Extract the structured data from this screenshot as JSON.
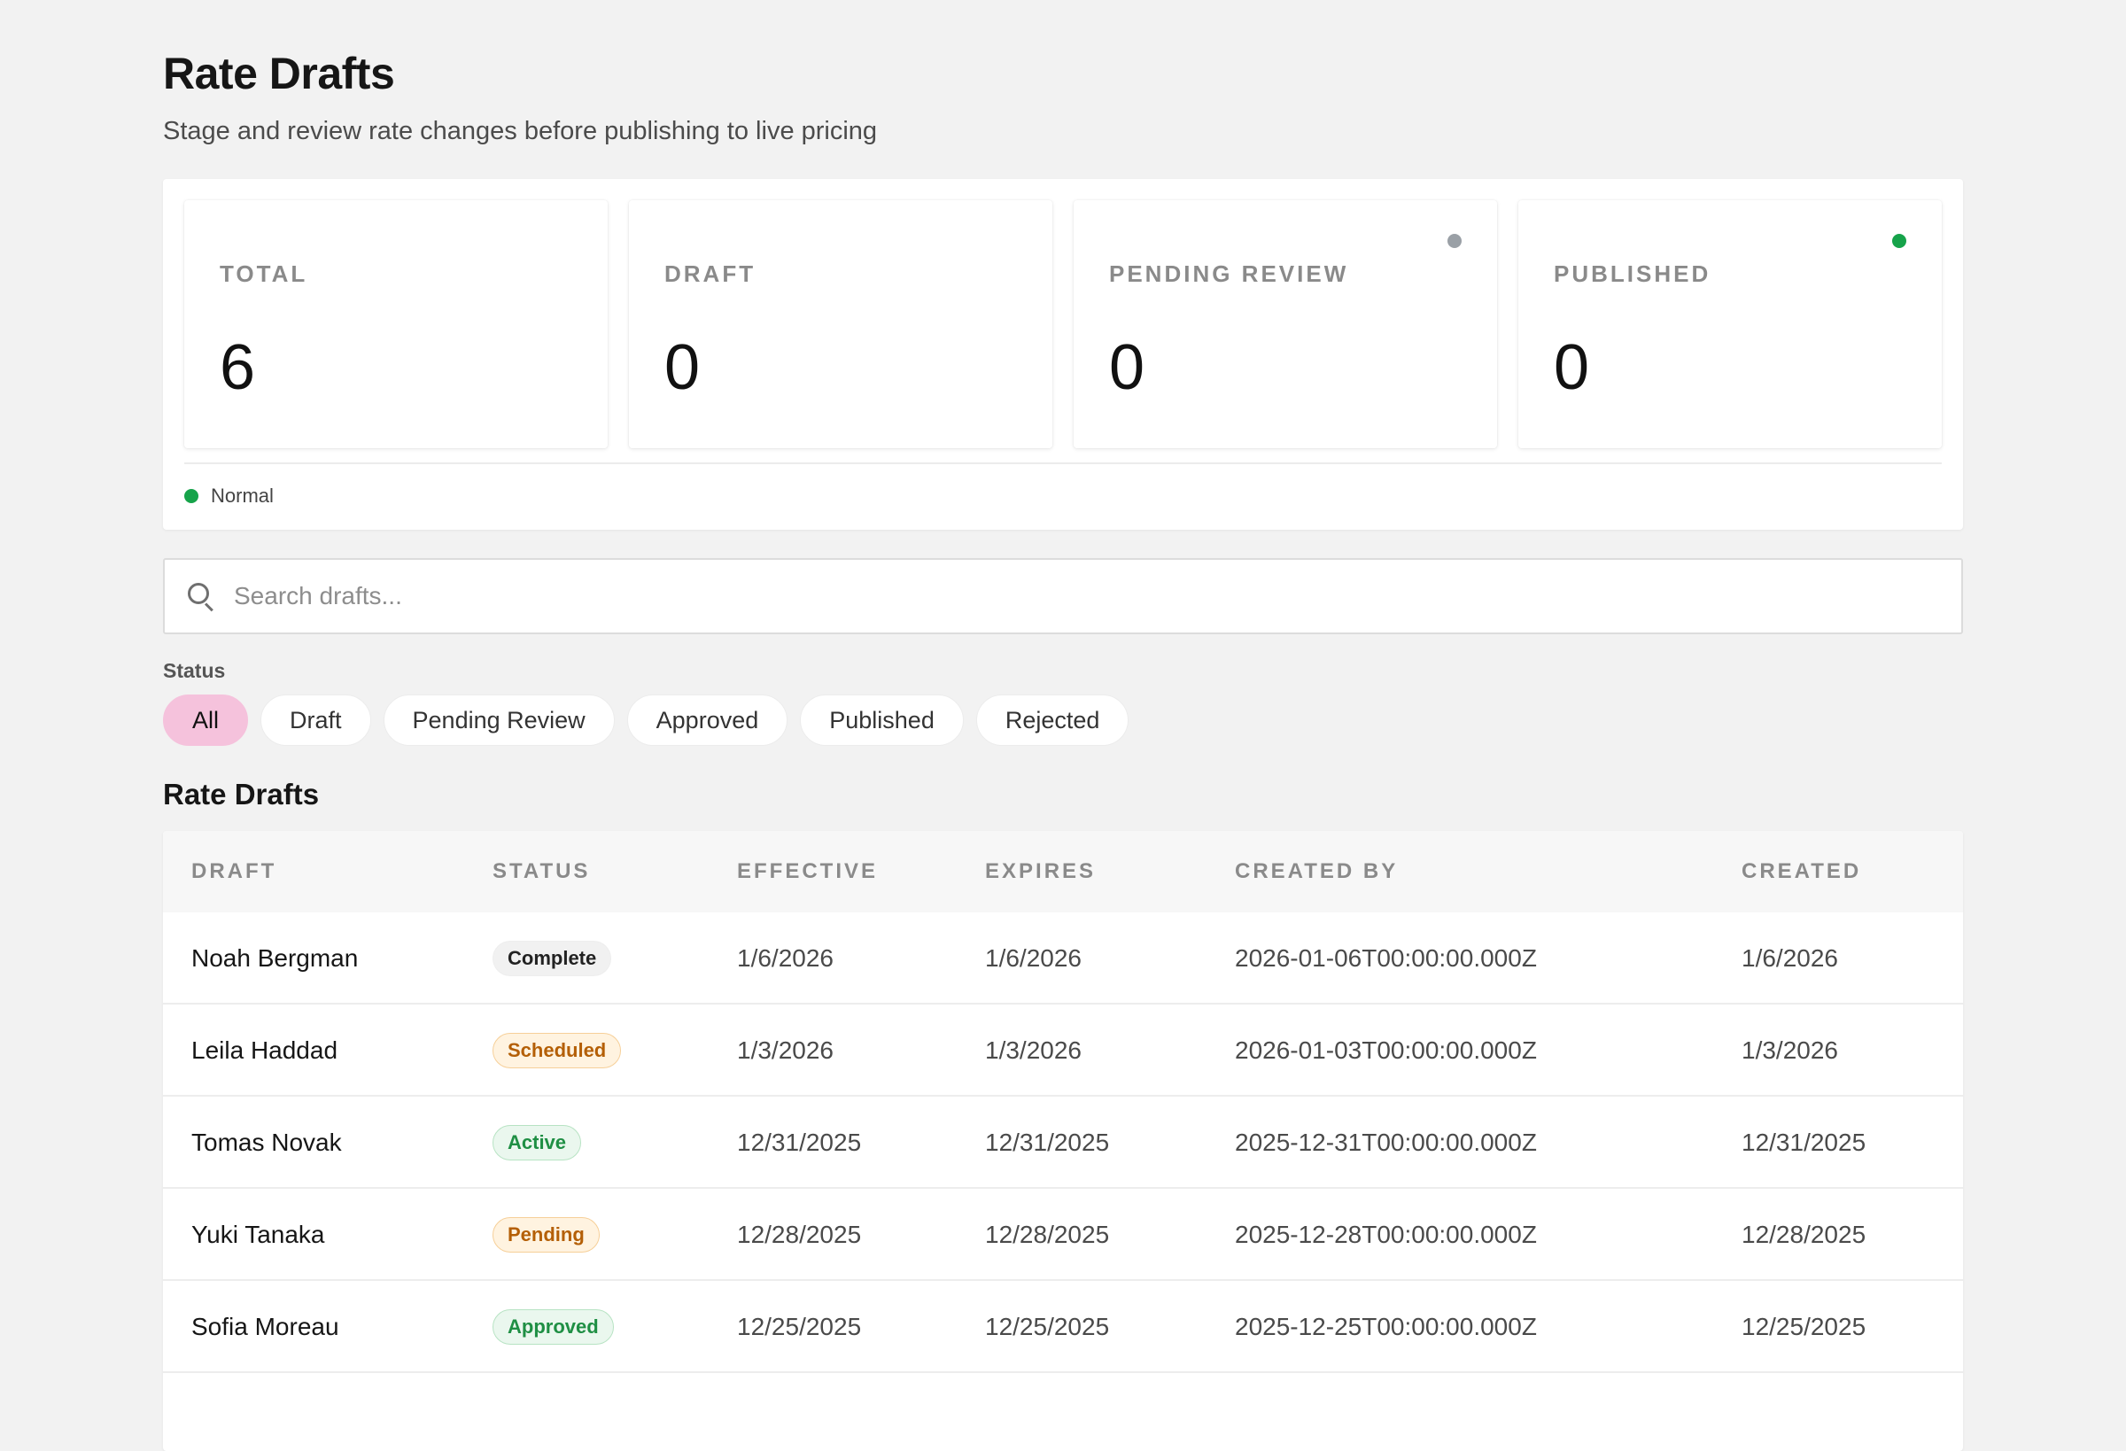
{
  "header": {
    "title": "Rate Drafts",
    "subtitle": "Stage and review rate changes before publishing to live pricing"
  },
  "stats": [
    {
      "label": "TOTAL",
      "value": "6",
      "dot": null
    },
    {
      "label": "DRAFT",
      "value": "0",
      "dot": null
    },
    {
      "label": "PENDING REVIEW",
      "value": "0",
      "dot": "#9aa0a6"
    },
    {
      "label": "PUBLISHED",
      "value": "0",
      "dot": "#16a34a"
    }
  ],
  "legend": {
    "label": "Normal",
    "color": "#16a34a"
  },
  "search": {
    "placeholder": "Search drafts...",
    "value": ""
  },
  "filters": {
    "label": "Status",
    "options": [
      "All",
      "Draft",
      "Pending Review",
      "Approved",
      "Published",
      "Rejected"
    ],
    "selected": "All"
  },
  "table": {
    "title": "Rate Drafts",
    "columns": [
      "DRAFT",
      "STATUS",
      "EFFECTIVE",
      "EXPIRES",
      "CREATED BY",
      "CREATED"
    ],
    "rows": [
      {
        "draft": "Noah Bergman",
        "status": "Complete",
        "status_kind": "complete",
        "effective": "1/6/2026",
        "expires": "1/6/2026",
        "created_by": "2026-01-06T00:00:00.000Z",
        "created": "1/6/2026"
      },
      {
        "draft": "Leila Haddad",
        "status": "Scheduled",
        "status_kind": "scheduled",
        "effective": "1/3/2026",
        "expires": "1/3/2026",
        "created_by": "2026-01-03T00:00:00.000Z",
        "created": "1/3/2026"
      },
      {
        "draft": "Tomas Novak",
        "status": "Active",
        "status_kind": "active",
        "effective": "12/31/2025",
        "expires": "12/31/2025",
        "created_by": "2025-12-31T00:00:00.000Z",
        "created": "12/31/2025"
      },
      {
        "draft": "Yuki Tanaka",
        "status": "Pending",
        "status_kind": "pending",
        "effective": "12/28/2025",
        "expires": "12/28/2025",
        "created_by": "2025-12-28T00:00:00.000Z",
        "created": "12/28/2025"
      },
      {
        "draft": "Sofia Moreau",
        "status": "Approved",
        "status_kind": "approved",
        "effective": "12/25/2025",
        "expires": "12/25/2025",
        "created_by": "2025-12-25T00:00:00.000Z",
        "created": "12/25/2025"
      }
    ]
  },
  "colors": {
    "background": "#f2f2f2",
    "accent_chip": "#f5c2dc",
    "success": "#16a34a",
    "neutral_dot": "#9aa0a6"
  },
  "icons": {
    "search": "search-icon"
  }
}
